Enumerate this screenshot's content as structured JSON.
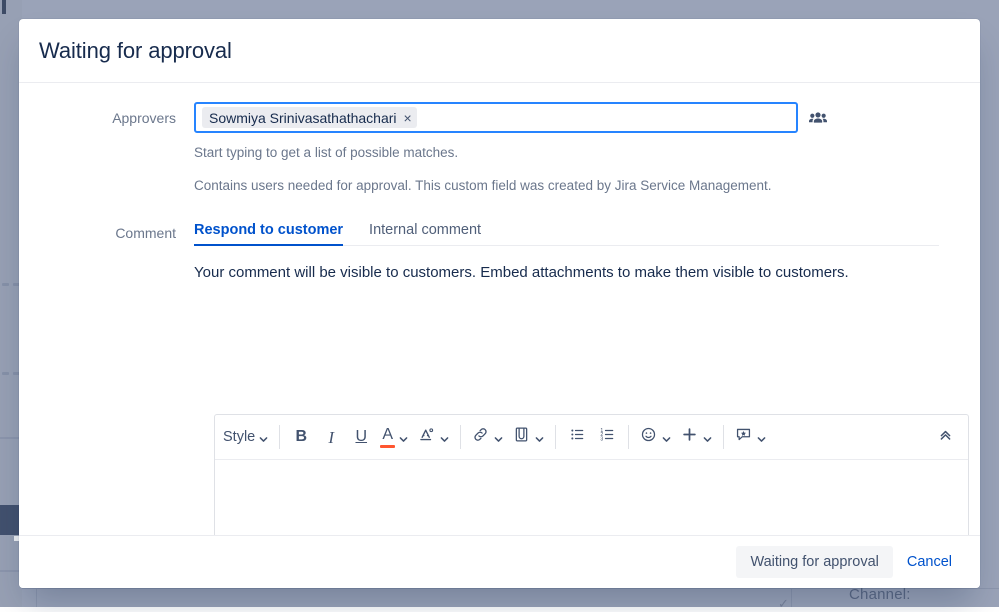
{
  "background": {
    "channel_label": "Channel:",
    "check_glyph": "✓"
  },
  "modal": {
    "title": "Waiting for approval",
    "fields": {
      "approvers": {
        "label": "Approvers",
        "chips": [
          {
            "name": "Sowmiya Srinivasathathachari",
            "remove_glyph": "×"
          }
        ],
        "placeholder": "",
        "picker_icon": "people-group-icon",
        "helper_primary": "Start typing to get a list of possible matches.",
        "helper_secondary": "Contains users needed for approval. This custom field was created by Jira Service Management."
      },
      "comment": {
        "label": "Comment",
        "tabs": [
          {
            "label": "Respond to customer",
            "active": true
          },
          {
            "label": "Internal comment",
            "active": false
          }
        ],
        "visibility_note": "Your comment will be visible to customers. Embed attachments to make them visible to customers.",
        "editor": {
          "style_label": "Style",
          "buttons": [
            {
              "name": "bold",
              "glyph": "B"
            },
            {
              "name": "italic",
              "glyph": "I"
            },
            {
              "name": "underline",
              "glyph": "U"
            },
            {
              "name": "text-color",
              "glyph": "A",
              "color": "#ff5630"
            },
            {
              "name": "more-formatting",
              "glyph": "A"
            },
            {
              "name": "link",
              "glyph": "link"
            },
            {
              "name": "attachment",
              "glyph": "paperclip"
            },
            {
              "name": "bullet-list",
              "glyph": "list-bulleted"
            },
            {
              "name": "numbered-list",
              "glyph": "list-numbered"
            },
            {
              "name": "emoji",
              "glyph": "smiley"
            },
            {
              "name": "insert-more",
              "glyph": "plus"
            },
            {
              "name": "mention-comment",
              "glyph": "comment-star"
            },
            {
              "name": "collapse-toolbar",
              "glyph": "chevron-up-double"
            }
          ],
          "content": ""
        }
      }
    },
    "footer": {
      "submit_label": "Waiting for approval",
      "cancel_label": "Cancel"
    }
  },
  "colors": {
    "accent": "#0052cc",
    "focus_border": "#2684ff",
    "title": "#172b4d",
    "muted": "#6b778c",
    "chip_bg": "#ebecf0",
    "text_color_swatch": "#ff5630",
    "backdrop": "#9aa3b8"
  }
}
